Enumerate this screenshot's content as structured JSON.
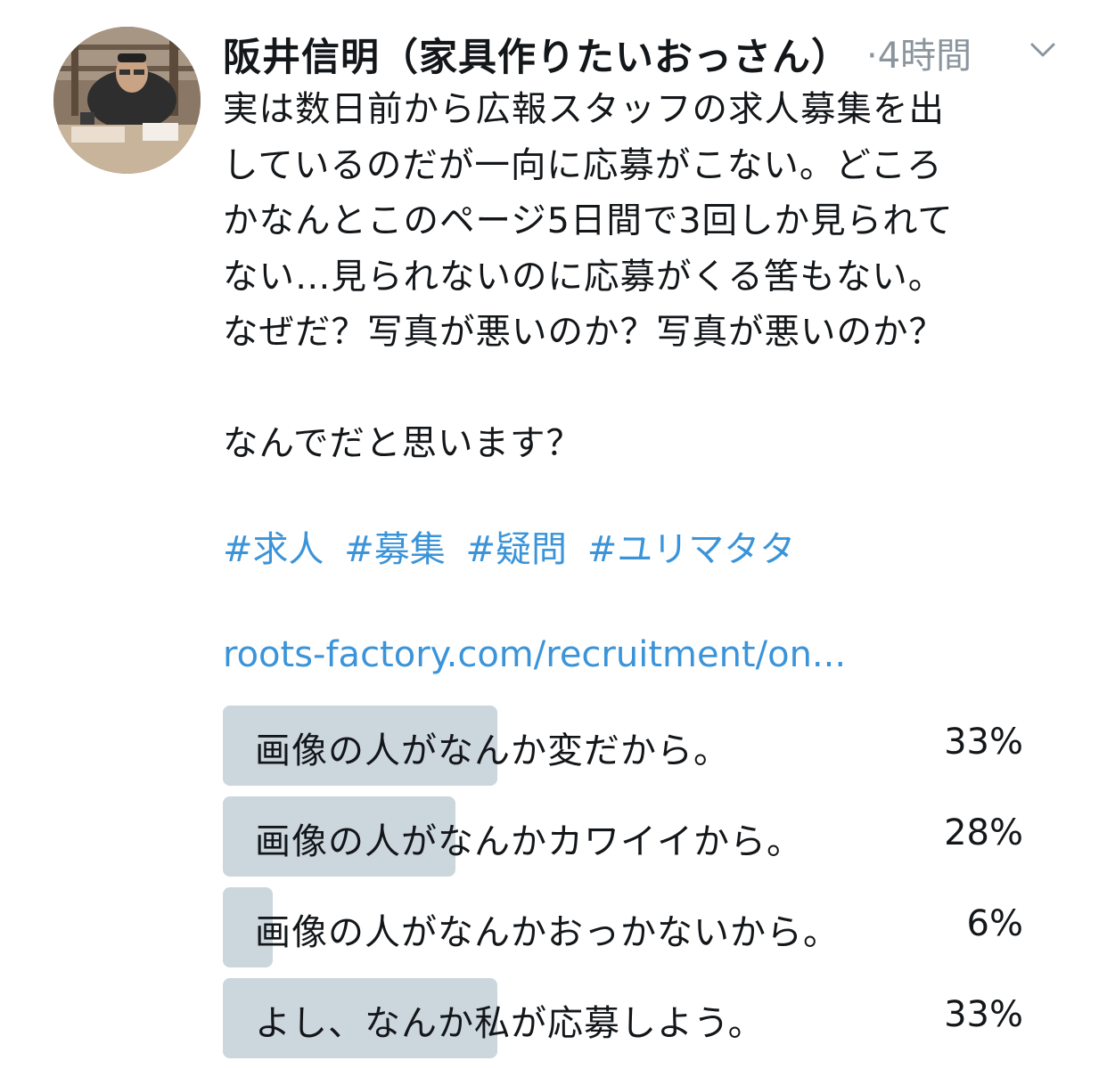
{
  "tweet": {
    "author_name": "阪井信明（家具作りたいおっさん）",
    "time": "·4時間",
    "text_lines": [
      "実は数日前から広報スタッフの求人募集を出",
      "しているのだが一向に応募がこない。どころ",
      "かなんとこのページ5日間で3回しか見られて",
      "ない…見られないのに応募がくる筈もない。",
      "なぜだ？写真が悪いのか？写真が悪いのか？",
      "なんでだと思います？"
    ],
    "hashtags": [
      "#求人",
      "#募集",
      "#疑問",
      "#ユリマタタ"
    ],
    "link": "roots-factory.com/recruitment/on..."
  },
  "poll": {
    "options": [
      {
        "label": "画像の人がなんか変だから。",
        "percent_text": "33%",
        "percent": 33
      },
      {
        "label": "画像の人がなんかカワイイから。",
        "percent_text": "28%",
        "percent": 28
      },
      {
        "label": "画像の人がなんかおっかないから。",
        "percent_text": "6%",
        "percent": 6
      },
      {
        "label": "よし、なんか私が応募しよう。",
        "percent_text": "33%",
        "percent": 33
      }
    ]
  },
  "colors": {
    "text": "#14171a",
    "muted": "#8a959e",
    "link": "#3b94d9",
    "poll_bar": "#ccd6dd"
  },
  "icons": {
    "avatar": "avatar-photo",
    "menu": "chevron-down-icon"
  }
}
